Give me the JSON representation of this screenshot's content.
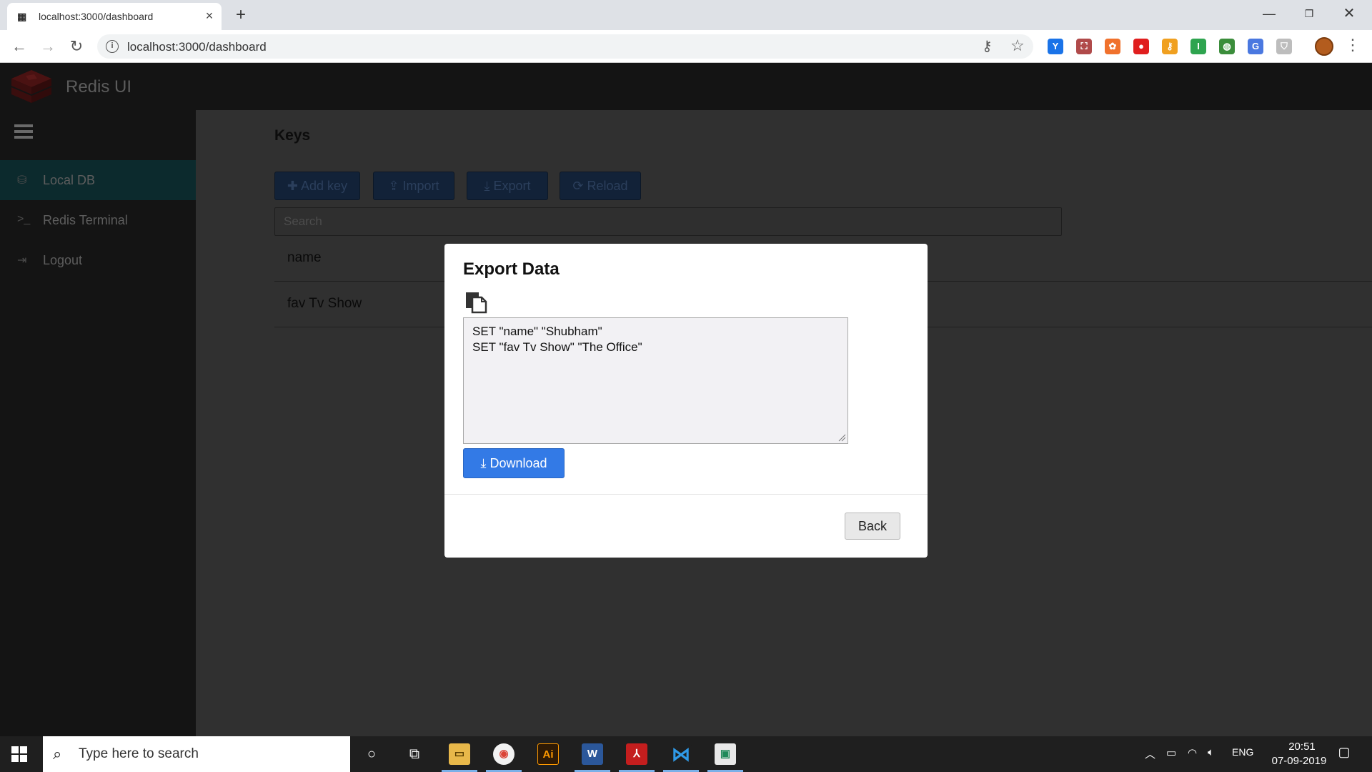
{
  "browser": {
    "tab_title": "localhost:3000/dashboard",
    "url": "localhost:3000/dashboard",
    "extensions": [
      {
        "name": "extension-y",
        "glyph": "Y",
        "color": "#1a73e8"
      },
      {
        "name": "extension-pdf",
        "glyph": "⛶",
        "color": "#b04a4a"
      },
      {
        "name": "extension-orange",
        "glyph": "✿",
        "color": "#f0712c"
      },
      {
        "name": "extension-red",
        "glyph": "●",
        "color": "#e01e1e"
      },
      {
        "name": "extension-key",
        "glyph": "⚷",
        "color": "#f0a020"
      },
      {
        "name": "extension-green",
        "glyph": "I",
        "color": "#2ea44f"
      },
      {
        "name": "extension-globe",
        "glyph": "◍",
        "color": "#3b8d3b"
      },
      {
        "name": "extension-translate",
        "glyph": "G",
        "color": "#4a78e0"
      },
      {
        "name": "extension-shield",
        "glyph": "⛉",
        "color": "#bdbdbd"
      }
    ]
  },
  "app": {
    "title": "Redis UI"
  },
  "sidebar": {
    "items": [
      {
        "label": "Local DB",
        "icon": "database-icon"
      },
      {
        "label": "Redis Terminal",
        "icon": "terminal-icon"
      },
      {
        "label": "Logout",
        "icon": "logout-icon"
      }
    ]
  },
  "main": {
    "title": "Keys",
    "buttons": {
      "add_key": "Add key",
      "import": "Import",
      "export": "Export",
      "reload": "Reload"
    },
    "search_placeholder": "Search",
    "keys": [
      "name",
      "fav Tv Show"
    ]
  },
  "modal": {
    "title": "Export Data",
    "export_text": "SET \"name\" \"Shubham\"\nSET \"fav Tv Show\" \"The Office\"",
    "download_label": "Download",
    "back_label": "Back"
  },
  "taskbar": {
    "search_text": "Type here to search",
    "language": "ENG",
    "time": "20:51",
    "date": "07-09-2019"
  }
}
